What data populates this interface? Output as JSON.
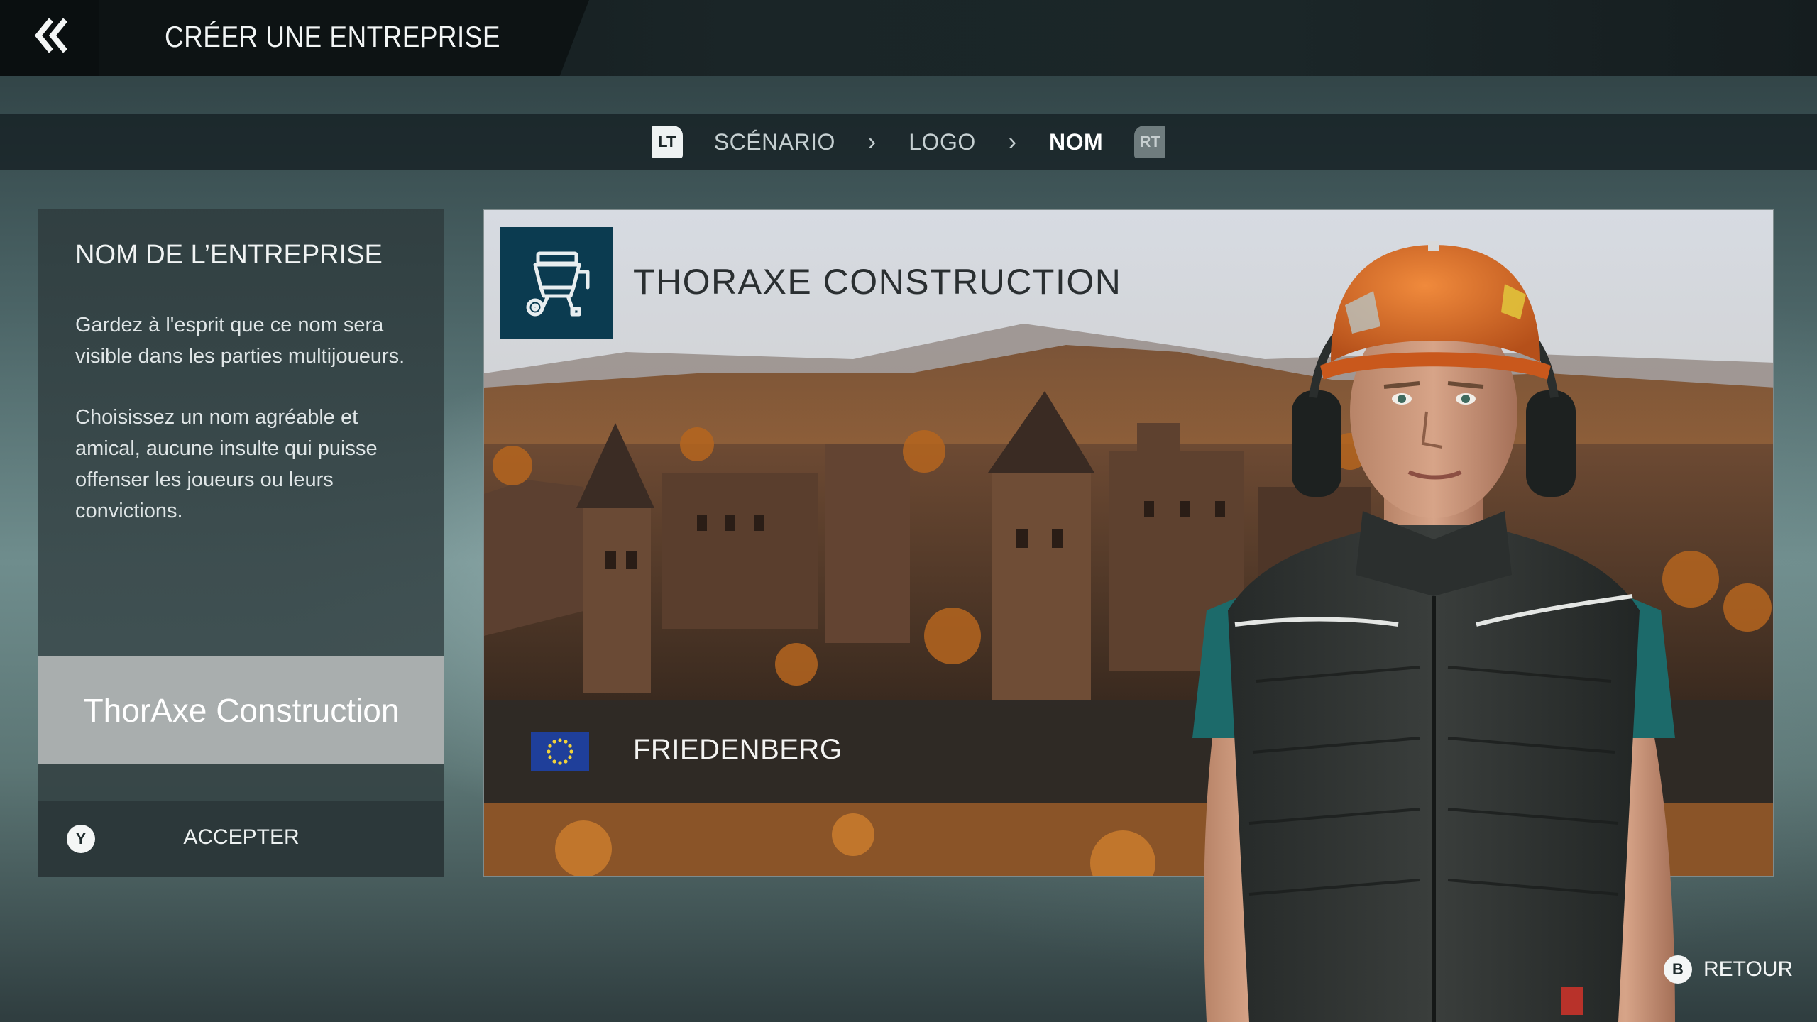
{
  "header": {
    "title": "CRÉER UNE ENTREPRISE",
    "back_icon": "double-chevron-left-icon"
  },
  "steps": {
    "prev_bumper": "LT",
    "next_bumper": "RT",
    "items": [
      {
        "label": "SCÉNARIO",
        "active": false
      },
      {
        "label": "LOGO",
        "active": false
      },
      {
        "label": "NOM",
        "active": true
      }
    ],
    "separator": "›"
  },
  "panel": {
    "title": "NOM DE L’ENTREPRISE",
    "paragraph1": "Gardez à l'esprit que ce nom sera visible dans les parties multijoueurs.",
    "paragraph2": "Choisissez un nom agréable et amical, aucune insulte qui puisse offenser les joueurs ou leurs convictions.",
    "input_value": "ThorAxe Construction",
    "accept_button_glyph": "Y",
    "accept_label": "ACCEPTER"
  },
  "preview": {
    "company_name": "THORAXE CONSTRUCTION",
    "logo_icon": "mortar-mixer-icon",
    "location": "FRIEDENBERG",
    "flag_icon": "eu-flag-icon"
  },
  "footer": {
    "back_button_glyph": "B",
    "back_label": "RETOUR"
  },
  "colors": {
    "logo_bg": "#0b3b50",
    "input_bg": "#a9aeae",
    "helmet": "#d7661e",
    "vest": "#2f3332",
    "shirt": "#1d6f6f"
  }
}
